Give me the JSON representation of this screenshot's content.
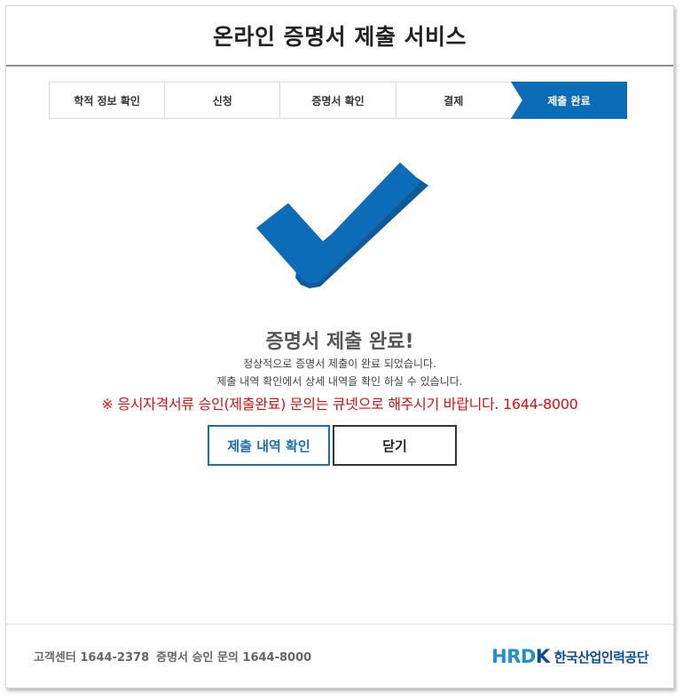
{
  "header": {
    "title": "온라인 증명서 제출 서비스"
  },
  "steps": [
    {
      "label": "학적 정보 확인",
      "active": false
    },
    {
      "label": "신청",
      "active": false
    },
    {
      "label": "증명서 확인",
      "active": false
    },
    {
      "label": "결제",
      "active": false
    },
    {
      "label": "제출 완료",
      "active": true
    }
  ],
  "result": {
    "icon": "checkmark-icon",
    "title": "증명서 제출 완료!",
    "message_1": "정상적으로 증명서 제출이 완료 되었습니다.",
    "message_2": "제출 내역 확인에서 상세 내역을 확인 하실 수 있습니다.",
    "notice": "※ 응시자격서류 승인(제출완료) 문의는 큐넷으로 해주시기 바랍니다. 1644-8000"
  },
  "buttons": {
    "history_label": "제출 내역 확인",
    "close_label": "닫기"
  },
  "footer": {
    "customer_center": "고객센터 1644-2378",
    "approval_inquiry": "증명서 승인 문의 1644-8000",
    "logo_mark_1": "HRD",
    "logo_mark_2": "K",
    "logo_text": "한국산업인력공단"
  },
  "colors": {
    "accent": "#0d6cb7",
    "notice_red": "#d81010",
    "button_blue": "#1c6fa8"
  }
}
